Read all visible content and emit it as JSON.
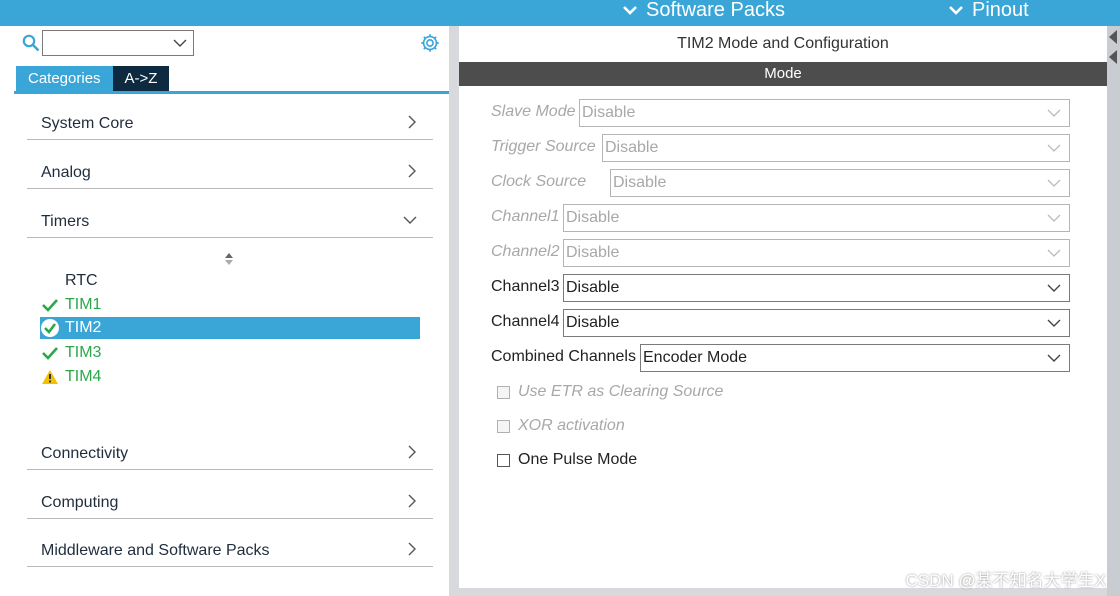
{
  "top_bar": {
    "software_packs": "Software Packs",
    "pinout": "Pinout"
  },
  "left_panel": {
    "search_value": "",
    "tabs": [
      {
        "label": "Categories",
        "active": true
      },
      {
        "label": "A->Z",
        "active": false
      }
    ],
    "categories": [
      {
        "label": "System Core",
        "expanded": false
      },
      {
        "label": "Analog",
        "expanded": false
      },
      {
        "label": "Timers",
        "expanded": true
      },
      {
        "label": "Connectivity",
        "expanded": false
      },
      {
        "label": "Computing",
        "expanded": false
      },
      {
        "label": "Middleware and Software Packs",
        "expanded": false
      }
    ],
    "timers": [
      {
        "label": "RTC",
        "status": "none"
      },
      {
        "label": "TIM1",
        "status": "ok"
      },
      {
        "label": "TIM2",
        "status": "ok",
        "selected": true
      },
      {
        "label": "TIM3",
        "status": "ok"
      },
      {
        "label": "TIM4",
        "status": "warning"
      }
    ]
  },
  "right_panel": {
    "title": "TIM2 Mode and Configuration",
    "section": "Mode",
    "fields": [
      {
        "label": "Slave Mode",
        "value": "Disable",
        "enabled": false
      },
      {
        "label": "Trigger Source",
        "value": "Disable",
        "enabled": false
      },
      {
        "label": "Clock Source",
        "value": "Disable",
        "enabled": false
      },
      {
        "label": "Channel1",
        "value": "Disable",
        "enabled": false
      },
      {
        "label": "Channel2",
        "value": "Disable",
        "enabled": false
      },
      {
        "label": "Channel3",
        "value": "Disable",
        "enabled": true
      },
      {
        "label": "Channel4",
        "value": "Disable",
        "enabled": true
      },
      {
        "label": "Combined Channels",
        "value": "Encoder Mode",
        "enabled": true
      }
    ],
    "checkboxes": [
      {
        "label": "Use ETR as Clearing Source",
        "checked": false,
        "enabled": false
      },
      {
        "label": "XOR activation",
        "checked": false,
        "enabled": false
      },
      {
        "label": "One Pulse Mode",
        "checked": false,
        "enabled": true
      }
    ]
  },
  "watermark": "CSDN @某不知名大学生X",
  "colors": {
    "accent": "#3aa6d8",
    "tab_dark": "#0d2a40",
    "ok_green": "#2aa84a",
    "warn_yellow": "#f2c200",
    "mode_bar": "#4d4d4d"
  },
  "icons": {
    "search": "search-icon",
    "settings": "gear-icon",
    "ok": "check-icon",
    "warning": "warning-icon"
  }
}
